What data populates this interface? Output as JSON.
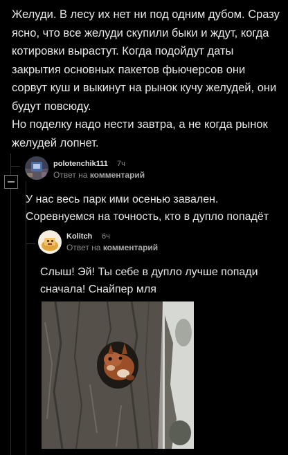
{
  "post": {
    "paragraphs": [
      "Желуди. В лесу их нет ни под одним дубом. Сразу ясно, что все желуди скупили быки и ждут, когда котировки вырастут. Когда подойдут даты закрытия основных пакетов фьючерсов они сорвут куш и выкинут на рынок кучу желудей, они будут повсюду.",
      "Но поделку надо нести завтра, а не когда рынок желудей лопнет."
    ]
  },
  "comments": [
    {
      "username": "polotenchik111",
      "time": "7ч",
      "reply_prefix": "Ответ на",
      "reply_target": "комментарий",
      "text": "У нас весь парк ими осенью завален. Соревнуемся на точность, кто в дупло попадёт"
    },
    {
      "username": "Kolitch",
      "time": "6ч",
      "reply_prefix": "Ответ на",
      "reply_target": "комментарий",
      "text": "Слыш! Эй! Ты себе в дупло лучше попади сначала! Снайпер мля"
    }
  ],
  "icons": {
    "collapse": "minus-square-icon"
  },
  "colors": {
    "background": "#000000",
    "text": "#e8e8e8",
    "muted": "#8a8a8a",
    "thread_line": "#2e2e2e"
  }
}
